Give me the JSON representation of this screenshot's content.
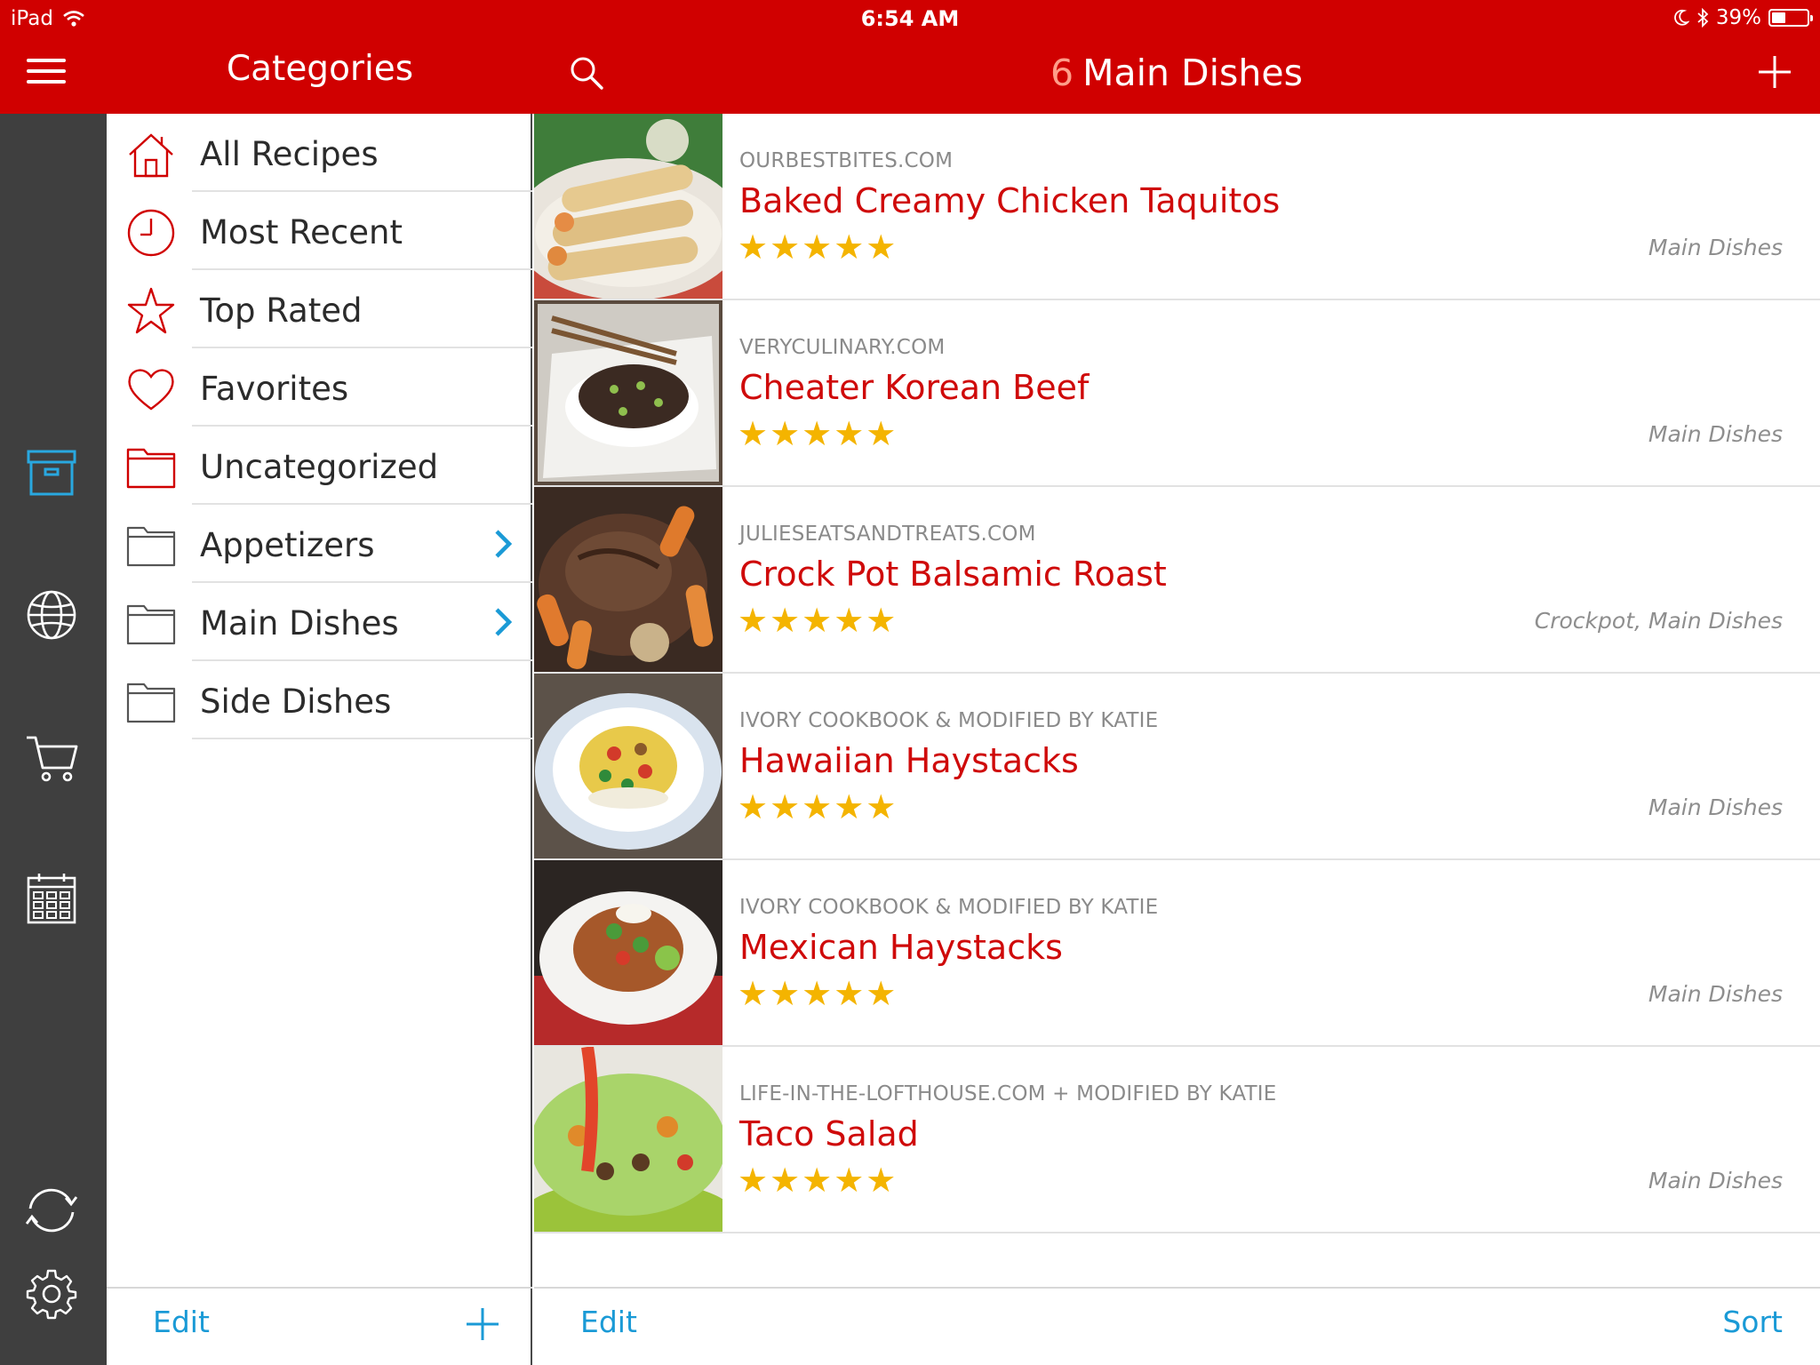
{
  "status_bar": {
    "device": "iPad",
    "time": "6:54 AM",
    "battery": "39%",
    "battery_level": 0.39
  },
  "nav": {
    "categories_title": "Categories",
    "main_count": "6",
    "main_title": "Main Dishes"
  },
  "sidebar": {
    "items": [
      {
        "label": "All Recipes",
        "icon": "home-icon"
      },
      {
        "label": "Most Recent",
        "icon": "clock-icon"
      },
      {
        "label": "Top Rated",
        "icon": "star-icon"
      },
      {
        "label": "Favorites",
        "icon": "heart-icon"
      },
      {
        "label": "Uncategorized",
        "icon": "folder-icon"
      },
      {
        "label": "Appetizers",
        "icon": "folder-icon",
        "has_children": true
      },
      {
        "label": "Main Dishes",
        "icon": "folder-icon",
        "has_children": true
      },
      {
        "label": "Side Dishes",
        "icon": "folder-icon"
      }
    ],
    "edit_label": "Edit"
  },
  "rail": [
    "recipes-box-icon",
    "globe-icon",
    "cart-icon",
    "calendar-icon",
    "sync-icon",
    "gear-icon"
  ],
  "recipes": {
    "items": [
      {
        "source": "OURBESTBITES.COM",
        "title": "Baked Creamy Chicken Taquitos",
        "stars": "★★★★★",
        "rating": 5,
        "categories": "Main Dishes"
      },
      {
        "source": "VERYCULINARY.COM",
        "title": "Cheater Korean Beef",
        "stars": "★★★★★",
        "rating": 5,
        "categories": "Main Dishes"
      },
      {
        "source": "JULIESEATSANDTREATS.COM",
        "title": "Crock Pot Balsamic Roast",
        "stars": "★★★★★",
        "rating": 5,
        "categories": "Crockpot, Main Dishes"
      },
      {
        "source": "IVORY COOKBOOK & MODIFIED BY KATIE",
        "title": "Hawaiian Haystacks",
        "stars": "★★★★★",
        "rating": 5,
        "categories": "Main Dishes"
      },
      {
        "source": "IVORY COOKBOOK & MODIFIED BY KATIE",
        "title": "Mexican Haystacks",
        "stars": "★★★★★",
        "rating": 5,
        "categories": "Main Dishes"
      },
      {
        "source": "LIFE-IN-THE-LOFTHOUSE.COM + MODIFIED BY KATIE",
        "title": "Taco Salad",
        "stars": "★★★★★",
        "rating": 5,
        "categories": "Main Dishes"
      }
    ],
    "edit_label": "Edit",
    "sort_label": "Sort"
  },
  "colors": {
    "brand_red": "#d00000",
    "title_red": "#cf0a0a",
    "link_blue": "#1a9ad6",
    "star_gold": "#f4b400",
    "rail_gray": "#3f3f3f"
  }
}
